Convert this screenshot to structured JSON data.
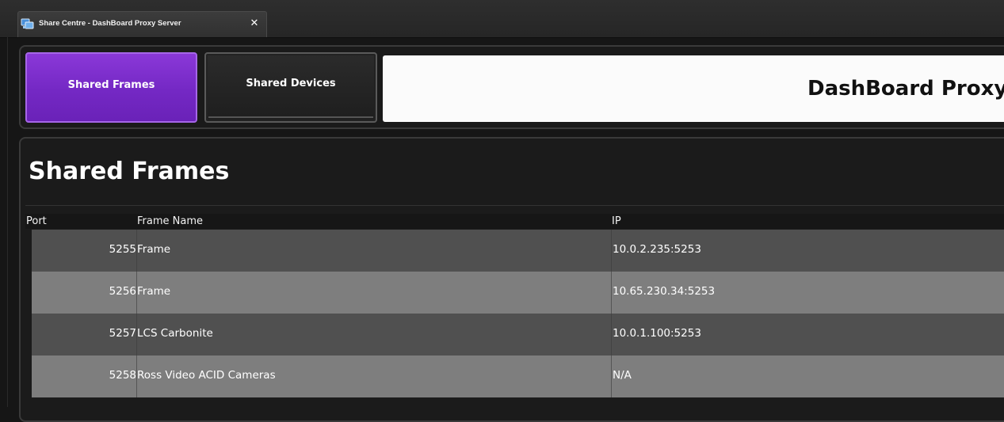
{
  "window": {
    "tab_title": "Share Centre - DashBoard Proxy Server",
    "close_glyph": "✕",
    "app_icon": "share-centre-app-icon"
  },
  "nav": {
    "shared_frames_label": "Shared Frames",
    "shared_devices_label": "Shared Devices",
    "active_tab": "Shared Frames",
    "accent_color": "#7a2ec8"
  },
  "banner": {
    "title": "DashBoard Proxy Server"
  },
  "main": {
    "page_title": "Shared Frames",
    "columns": [
      "Port",
      "Frame Name",
      "IP"
    ],
    "rows": [
      {
        "port": "5255",
        "name": "Frame",
        "ip": "10.0.2.235:5253"
      },
      {
        "port": "5256",
        "name": "Frame",
        "ip": "10.65.230.34:5253"
      },
      {
        "port": "5257",
        "name": "LCS Carbonite",
        "ip": "10.0.1.100:5253"
      },
      {
        "port": "5258",
        "name": "Ross Video ACID Cameras",
        "ip": "N/A"
      }
    ]
  }
}
